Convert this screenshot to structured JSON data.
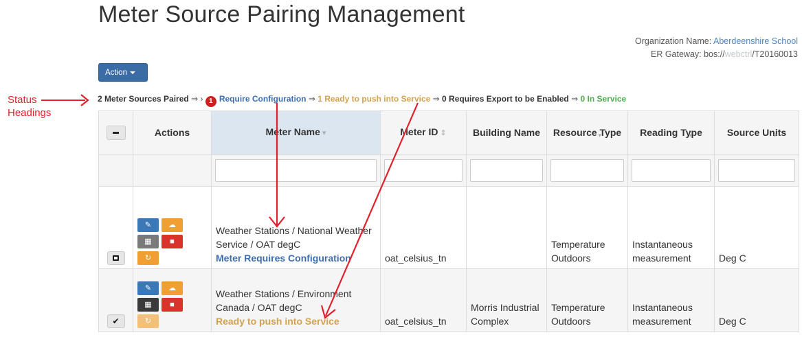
{
  "page": {
    "title": "Meter Source Pairing Management"
  },
  "org": {
    "name_label": "Organization Name:",
    "name_value": "Aberdeenshire School",
    "gateway_label": "ER Gateway: bos://",
    "gateway_blur": "webctrl",
    "gateway_tail": "/T20160013"
  },
  "toolbar": {
    "action_label": "Action"
  },
  "annotation": {
    "line1": "Status",
    "line2": "Headings",
    "color": "#e0202a"
  },
  "status_bar": {
    "paired": "2 Meter Sources Paired",
    "arrow": "⇒",
    "sub_arrow": "›",
    "require_count": "1",
    "require_text": "Require Configuration",
    "ready": "1 Ready to push into Service",
    "export": "0 Requires Export to be Enabled",
    "in_service": "0 In Service"
  },
  "table": {
    "headers": {
      "actions": "Actions",
      "meter_name": "Meter Name",
      "meter_id": "Meter ID",
      "building_name": "Building Name",
      "resource_type": "Resource Type",
      "reading_type": "Reading Type",
      "source_units": "Source Units"
    },
    "sort_glyphs": {
      "meter_name": "▾",
      "meter_id": "⇕",
      "minor": "▾"
    },
    "rows": [
      {
        "meter_name": "Weather Stations / National Weather Service / OAT degC",
        "status": "Meter Requires Configuration",
        "meter_id": "oat_celsius_tn",
        "building_name": "",
        "resource_type": "Temperature Outdoors",
        "reading_type": "Instantaneous measurement",
        "source_units": "Deg C"
      },
      {
        "meter_name": "Weather Stations / Environment Canada / OAT degC",
        "status": "Ready to push into Service",
        "meter_id": "oat_celsius_tn",
        "building_name": "Morris Industrial Complex",
        "resource_type": "Temperature Outdoors",
        "reading_type": "Instantaneous measurement",
        "source_units": "Deg C"
      }
    ]
  },
  "colors": {
    "primary_blue": "#3b6ca5",
    "status_blue": "#3d6db0",
    "status_gold": "#d4a24e",
    "status_green": "#4cae4c",
    "badge_red": "#cc1f1f"
  }
}
